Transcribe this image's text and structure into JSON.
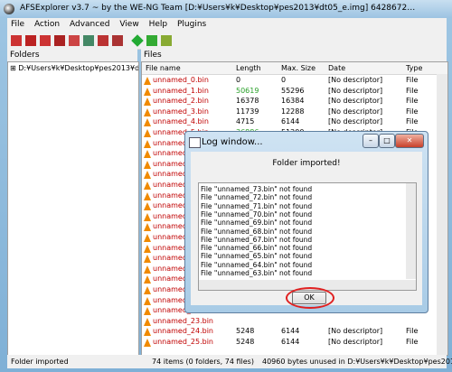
{
  "window": {
    "title": "AFSExplorer v3.7  ~ by the WE-NG Team [D:¥Users¥k¥Desktop¥pes2013¥dt05_e.img] 6428672…"
  },
  "menu": [
    "File",
    "Action",
    "Advanced",
    "View",
    "Help",
    "Plugins"
  ],
  "toolbar": {
    "icons": [
      "open-icon",
      "save-icon",
      "import-icon",
      "export-icon",
      "rebuild-icon",
      "tool-icon",
      "save-as-icon",
      "delete-icon",
      "green-gem-icon",
      "waveform-icon",
      "settings-icon"
    ]
  },
  "folders": {
    "header": "Folders",
    "node": "D:¥Users¥k¥Desktop¥pes2013¥dt05_"
  },
  "files": {
    "header": "Files",
    "columns": [
      "File name",
      "Length",
      "Max. Size",
      "Date",
      "Type"
    ],
    "rows": [
      {
        "name": "unnamed_0.bin",
        "length": "0",
        "max": "0",
        "date": "[No descriptor]",
        "type": "File"
      },
      {
        "name": "unnamed_1.bin",
        "length": "50619",
        "max": "55296",
        "date": "[No descriptor]",
        "type": "File"
      },
      {
        "name": "unnamed_2.bin",
        "length": "16378",
        "max": "16384",
        "date": "[No descriptor]",
        "type": "File"
      },
      {
        "name": "unnamed_3.bin",
        "length": "11739",
        "max": "12288",
        "date": "[No descriptor]",
        "type": "File"
      },
      {
        "name": "unnamed_4.bin",
        "length": "4715",
        "max": "6144",
        "date": "[No descriptor]",
        "type": "File"
      },
      {
        "name": "unnamed_5.bin",
        "length": "36886",
        "max": "51200",
        "date": "[No descriptor]",
        "type": "File"
      },
      {
        "name": "unnamed_6.bin",
        "length": "",
        "max": "",
        "date": "",
        "type": ""
      },
      {
        "name": "unnamed_7.bin",
        "length": "",
        "max": "",
        "date": "",
        "type": ""
      },
      {
        "name": "unnamed_8.bin",
        "length": "",
        "max": "",
        "date": "",
        "type": ""
      },
      {
        "name": "unnamed_9.bin",
        "length": "",
        "max": "",
        "date": "",
        "type": ""
      },
      {
        "name": "unnamed_10.bin",
        "length": "",
        "max": "",
        "date": "",
        "type": ""
      },
      {
        "name": "unnamed_11.bin",
        "length": "",
        "max": "",
        "date": "",
        "type": ""
      },
      {
        "name": "unnamed_12.bin",
        "length": "",
        "max": "",
        "date": "",
        "type": ""
      },
      {
        "name": "unnamed_13.bin",
        "length": "",
        "max": "",
        "date": "",
        "type": ""
      },
      {
        "name": "unnamed_14.bin",
        "length": "",
        "max": "",
        "date": "",
        "type": ""
      },
      {
        "name": "unnamed_15.bin",
        "length": "",
        "max": "",
        "date": "",
        "type": ""
      },
      {
        "name": "unnamed_16.bin",
        "length": "",
        "max": "",
        "date": "",
        "type": ""
      },
      {
        "name": "unnamed_17.bin",
        "length": "",
        "max": "",
        "date": "",
        "type": ""
      },
      {
        "name": "unnamed_18.bin",
        "length": "",
        "max": "",
        "date": "",
        "type": ""
      },
      {
        "name": "unnamed_19.bin",
        "length": "",
        "max": "",
        "date": "",
        "type": ""
      },
      {
        "name": "unnamed_20.bin",
        "length": "",
        "max": "",
        "date": "",
        "type": ""
      },
      {
        "name": "unnamed_21.bin",
        "length": "",
        "max": "",
        "date": "",
        "type": ""
      },
      {
        "name": "unnamed_22.bin",
        "length": "",
        "max": "",
        "date": "",
        "type": ""
      },
      {
        "name": "unnamed_23.bin",
        "length": "",
        "max": "",
        "date": "",
        "type": ""
      },
      {
        "name": "unnamed_24.bin",
        "length": "5248",
        "max": "6144",
        "date": "[No descriptor]",
        "type": "File"
      },
      {
        "name": "unnamed_25.bin",
        "length": "5248",
        "max": "6144",
        "date": "[No descriptor]",
        "type": "File"
      }
    ]
  },
  "status": {
    "left": "Folder imported",
    "middle": "74 items (0 folders, 74 files)",
    "right": "40960 bytes unused in D:¥Users¥k¥Desktop¥pes2013¥"
  },
  "dialog": {
    "title": "Log window...",
    "message": "Folder imported!",
    "lines": [
      "File \"unnamed_73.bin\" not found",
      "File \"unnamed_72.bin\" not found",
      "File \"unnamed_71.bin\" not found",
      "File \"unnamed_70.bin\" not found",
      "File \"unnamed_69.bin\" not found",
      "File \"unnamed_68.bin\" not found",
      "File \"unnamed_67.bin\" not found",
      "File \"unnamed_66.bin\" not found",
      "File \"unnamed_65.bin\" not found",
      "File \"unnamed_64.bin\" not found",
      "File \"unnamed_63.bin\" not found"
    ],
    "ok": "OK"
  },
  "colors": {
    "name_red": "#c00000",
    "length_green": "#2aa02a",
    "ok_ring": "#e02020"
  }
}
